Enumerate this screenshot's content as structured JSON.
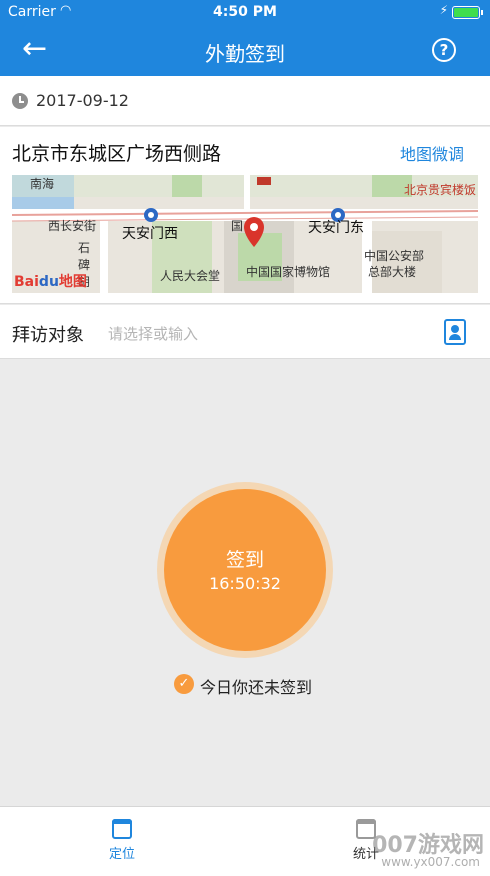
{
  "status_bar": {
    "carrier": "Carrier",
    "time": "4:50 PM"
  },
  "nav": {
    "title": "外勤签到",
    "back_icon": "arrow-left-icon",
    "help_icon": "question-circle-icon",
    "help_glyph": "?"
  },
  "date_row": {
    "date": "2017-09-12",
    "icon": "clock-icon"
  },
  "location": {
    "address": "北京市东城区广场西侧路",
    "adjust_label": "地图微调",
    "map_labels": [
      "南海",
      "西长安街",
      "天安门西",
      "天安门东",
      "人民大会堂",
      "中国国家博物馆",
      "中国公安部",
      "总部大楼",
      "石碑胡",
      "北京贵宾楼饭",
      "国"
    ],
    "map_logo": "Bai地图",
    "map_logo_parts": [
      "Bai",
      "du",
      "地图"
    ]
  },
  "visit": {
    "label": "拜访对象",
    "placeholder": "请选择或输入",
    "icon": "contact-book-icon"
  },
  "sign": {
    "label": "签到",
    "time": "16:50:32"
  },
  "sign_status": {
    "text": "今日你还未签到",
    "icon": "check-circle-icon"
  },
  "tabs": [
    {
      "label": "定位",
      "icon": "calendar-check-icon",
      "active": true
    },
    {
      "label": "统计",
      "icon": "stats-icon",
      "active": false
    }
  ],
  "watermark": {
    "text": "007游戏网",
    "url": "www.yx007.com"
  },
  "colors": {
    "primary": "#1f86dd",
    "accent": "#f89b3e",
    "ring": "#f4d7b4"
  }
}
